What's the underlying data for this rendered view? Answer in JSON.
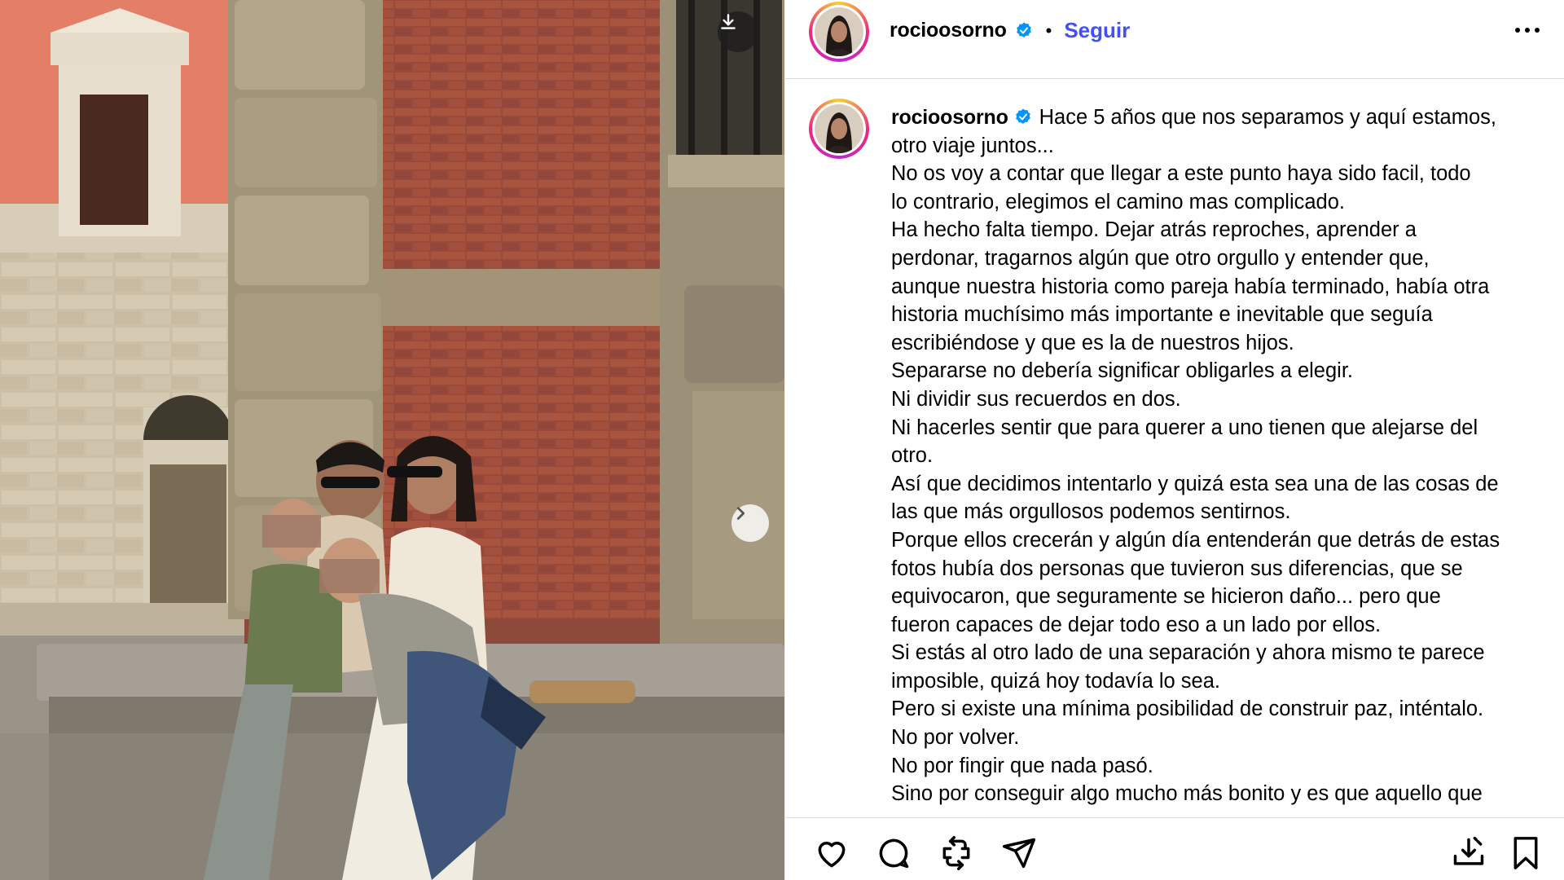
{
  "post": {
    "username": "rocioosorno",
    "follow_label": "Seguir",
    "separator": "•",
    "caption_lines": [
      "Hace 5 años que nos separamos y aquí estamos,",
      "otro viaje juntos...",
      "No os voy a contar que llegar a este punto haya sido facil, todo",
      "lo contrario, elegimos el camino mas complicado.",
      "Ha hecho falta tiempo. Dejar atrás reproches, aprender a",
      "perdonar, tragarnos algún que otro orgullo y entender que,",
      "aunque nuestra historia como pareja había terminado, había otra",
      "historia muchísimo más importante e inevitable que seguía",
      "escribiéndose y que es la de nuestros hijos.",
      "Separarse no debería significar obligarles a elegir.",
      "Ni dividir sus recuerdos en dos.",
      "Ni hacerles sentir que para querer a uno tienen que alejarse del",
      "otro.",
      "Así que decidimos intentarlo y quizá esta sea una de las cosas de",
      "las que más orgullosos podemos sentirnos.",
      "Porque ellos crecerán y algún día entenderán que detrás de estas",
      "fotos hubía dos personas que tuvieron sus diferencias, que se",
      "equivocaron, que seguramente se hicieron daño... pero que",
      "fueron capaces de dejar todo eso a un lado por ellos.",
      "Si estás al otro lado de una separación y ahora mismo te parece",
      "imposible, quizá hoy todavía lo sea.",
      "Pero si existe una mínima posibilidad de construir paz, inténtalo.",
      "No por volver.",
      "No por fingir que nada pasó.",
      "Sino por conseguir algo mucho más bonito y es que aquello que"
    ]
  },
  "icons": {
    "download": "download-icon",
    "next": "chevron-right-icon",
    "more": "more-options-icon",
    "verified": "verified-badge-icon",
    "like": "heart-icon",
    "comment": "comment-icon",
    "repost": "repost-icon",
    "share": "send-icon",
    "save_download": "download-tray-icon",
    "bookmark": "bookmark-icon"
  },
  "colors": {
    "follow": "#4150f7",
    "verified": "#0095f6",
    "divider": "#dbdbdb"
  }
}
